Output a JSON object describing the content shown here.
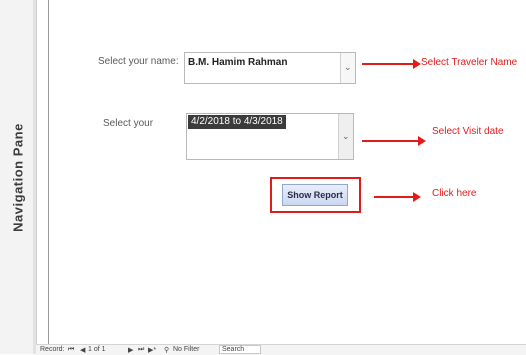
{
  "navigation_pane": {
    "title": "Navigation Pane"
  },
  "form": {
    "name_field": {
      "label": "Select your name:",
      "value": "B.M. Hamim Rahman",
      "dropdown_icon": "chevron-down"
    },
    "date_field": {
      "label": "Select your",
      "selected_value": "4/2/2018 to 4/3/2018",
      "scroll_icon": "chevron-down"
    },
    "show_report_button": {
      "label": "Show Report"
    }
  },
  "annotations": {
    "color": "#e21b1b",
    "select_traveler_name": "Select Traveler Name",
    "select_visit_date": "Select Visit date",
    "click_here": "Click here"
  },
  "record_bar": {
    "label": "Record:",
    "first_glyph": "⏮",
    "prev_glyph": "◀",
    "position": "1 of 1",
    "next_glyph": "▶",
    "last_glyph": "⏭",
    "new_glyph": "▶*",
    "filter_text": "No Filter",
    "search_placeholder": "Search"
  }
}
